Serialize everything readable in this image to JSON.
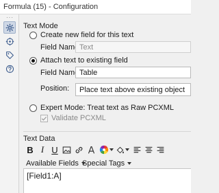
{
  "window": {
    "title": "Formula (15) - Configuration"
  },
  "sidebar": {
    "items": [
      {
        "icon": "gear-icon",
        "active": true
      },
      {
        "icon": "target-icon",
        "active": false
      },
      {
        "icon": "tag-icon",
        "active": false
      },
      {
        "icon": "help-icon",
        "active": false
      }
    ]
  },
  "text_mode": {
    "heading": "Text Mode",
    "create_new": {
      "label": "Create new field for this text",
      "selected": false,
      "field_label": "Field Name:",
      "field_value": "Text"
    },
    "attach_existing": {
      "label": "Attach text to existing field",
      "selected": true,
      "field_label": "Field Name:",
      "field_value": "Table",
      "position_label": "Position:",
      "position_value": "Place text above existing object"
    },
    "expert": {
      "label": "Expert Mode: Treat text as Raw PCXML",
      "selected": false,
      "validate_label": "Validate PCXML",
      "validate_checked": true
    }
  },
  "text_data": {
    "heading": "Text Data",
    "toolbar": {
      "bold": "B",
      "italic": "I",
      "underline": "U"
    },
    "available_fields": "Available Fields",
    "special_tags": "Special Tags",
    "content": "[Field1:A]"
  }
}
